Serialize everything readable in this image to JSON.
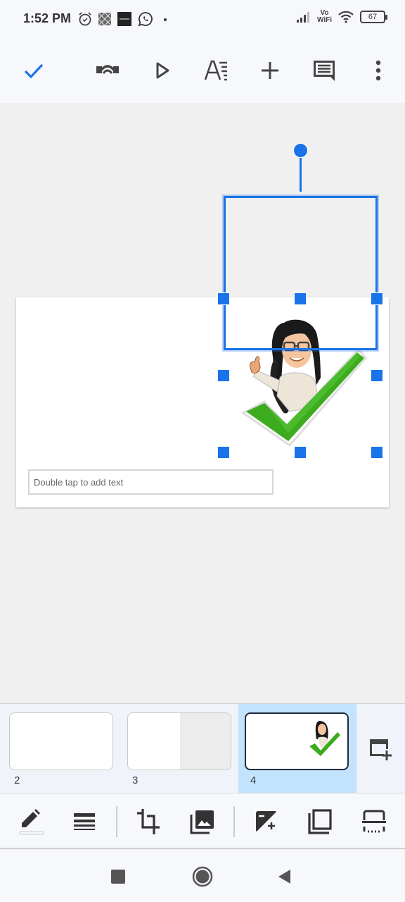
{
  "status_bar": {
    "time": "1:52 PM",
    "network_label_top": "Vo",
    "network_label_bottom": "WiFi",
    "battery": "67",
    "icons": [
      "alarm-icon",
      "app-icon",
      "news-icon",
      "whatsapp-icon",
      "dot-icon",
      "signal-icon",
      "vowifi-icon",
      "wifi-icon",
      "battery-icon"
    ]
  },
  "top_toolbar": {
    "buttons": [
      {
        "name": "done",
        "icon": "checkmark-icon"
      },
      {
        "name": "undo-redo",
        "icon": "undo-icon"
      },
      {
        "name": "present",
        "icon": "play-icon"
      },
      {
        "name": "format",
        "icon": "text-format-icon"
      },
      {
        "name": "insert",
        "icon": "plus-icon"
      },
      {
        "name": "comments",
        "icon": "comment-icon"
      },
      {
        "name": "more",
        "icon": "more-vert-icon"
      }
    ],
    "accent_color": "#1a73e8"
  },
  "slide": {
    "textbox_placeholder": "Double tap to add text",
    "selected_image": "bitmoji-checkmark-image",
    "selection_color": "#1a73e8"
  },
  "filmstrip": {
    "slides": [
      {
        "number": "2",
        "active": false
      },
      {
        "number": "3",
        "active": false
      },
      {
        "number": "4",
        "active": true
      }
    ],
    "active_color": "#c2e3fb",
    "add_slide_icon": "add-slide-icon"
  },
  "bottom_toolbar": {
    "buttons": [
      {
        "name": "border-color",
        "icon": "pencil-icon"
      },
      {
        "name": "border-weight",
        "icon": "line-weight-icon"
      },
      {
        "name": "crop",
        "icon": "crop-icon"
      },
      {
        "name": "replace-image",
        "icon": "image-library-icon"
      },
      {
        "name": "adjustments",
        "icon": "exposure-icon"
      },
      {
        "name": "arrange",
        "icon": "layers-icon"
      },
      {
        "name": "image-options",
        "icon": "border-options-icon"
      }
    ]
  },
  "nav_bar": {
    "buttons": [
      "recents",
      "home",
      "back"
    ]
  }
}
